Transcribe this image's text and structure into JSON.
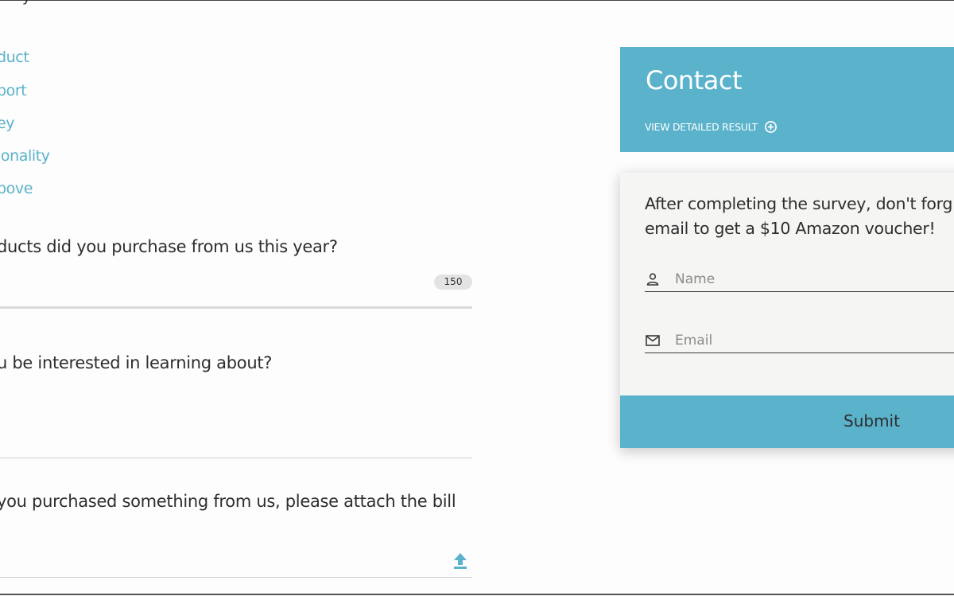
{
  "survey": {
    "options": [
      "duct",
      "port",
      "ey",
      "ionality",
      "bove"
    ],
    "questions": [
      "ducts did you purchase from us this year?",
      "u be interested in learning about?",
      "you purchased something from us, please attach the bill"
    ],
    "char_counter": "150"
  },
  "contact": {
    "title": "Contact",
    "detail_link": "VIEW DETAILED RESULT",
    "promo_line1": "After completing the survey, don't forg",
    "promo_line2": "email to get a $10 Amazon voucher!",
    "name_placeholder": "Name",
    "email_placeholder": "Email",
    "submit_label": "Submit"
  },
  "colors": {
    "accent": "#5ab2cb",
    "card_background": "#f5f5f3",
    "page_background": "#fdfdfd"
  },
  "icons": [
    "plus-circle-icon",
    "person-icon",
    "mail-icon",
    "upload-icon"
  ]
}
